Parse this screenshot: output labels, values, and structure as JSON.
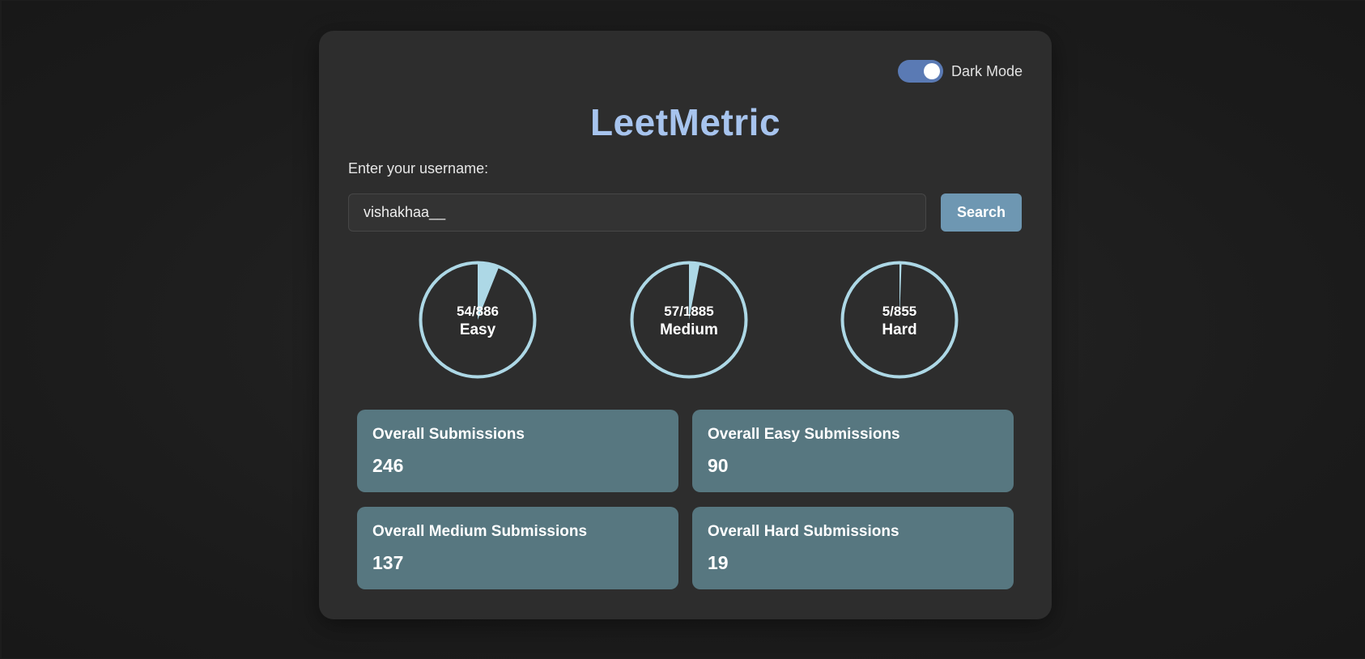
{
  "app": {
    "title": "LeetMetric",
    "theme_toggle": {
      "label": "Dark Mode",
      "on": true
    }
  },
  "search": {
    "label": "Enter your username:",
    "value": "vishakhaa__",
    "button_label": "Search"
  },
  "progress": [
    {
      "count_text": "54/886",
      "label": "Easy",
      "solved": 54,
      "total": 886
    },
    {
      "count_text": "57/1885",
      "label": "Medium",
      "solved": 57,
      "total": 1885
    },
    {
      "count_text": "5/855",
      "label": "Hard",
      "solved": 5,
      "total": 855
    }
  ],
  "stats": [
    {
      "title": "Overall Submissions",
      "value": "246"
    },
    {
      "title": "Overall Easy Submissions",
      "value": "90"
    },
    {
      "title": "Overall Medium Submissions",
      "value": "137"
    },
    {
      "title": "Overall Hard Submissions",
      "value": "19"
    }
  ],
  "colors": {
    "accent": "#a7c4ee",
    "progress_fill": "#add8e6",
    "toggle": "#5a7ab4",
    "button": "#6e97b2",
    "stat_card": "#577780"
  }
}
